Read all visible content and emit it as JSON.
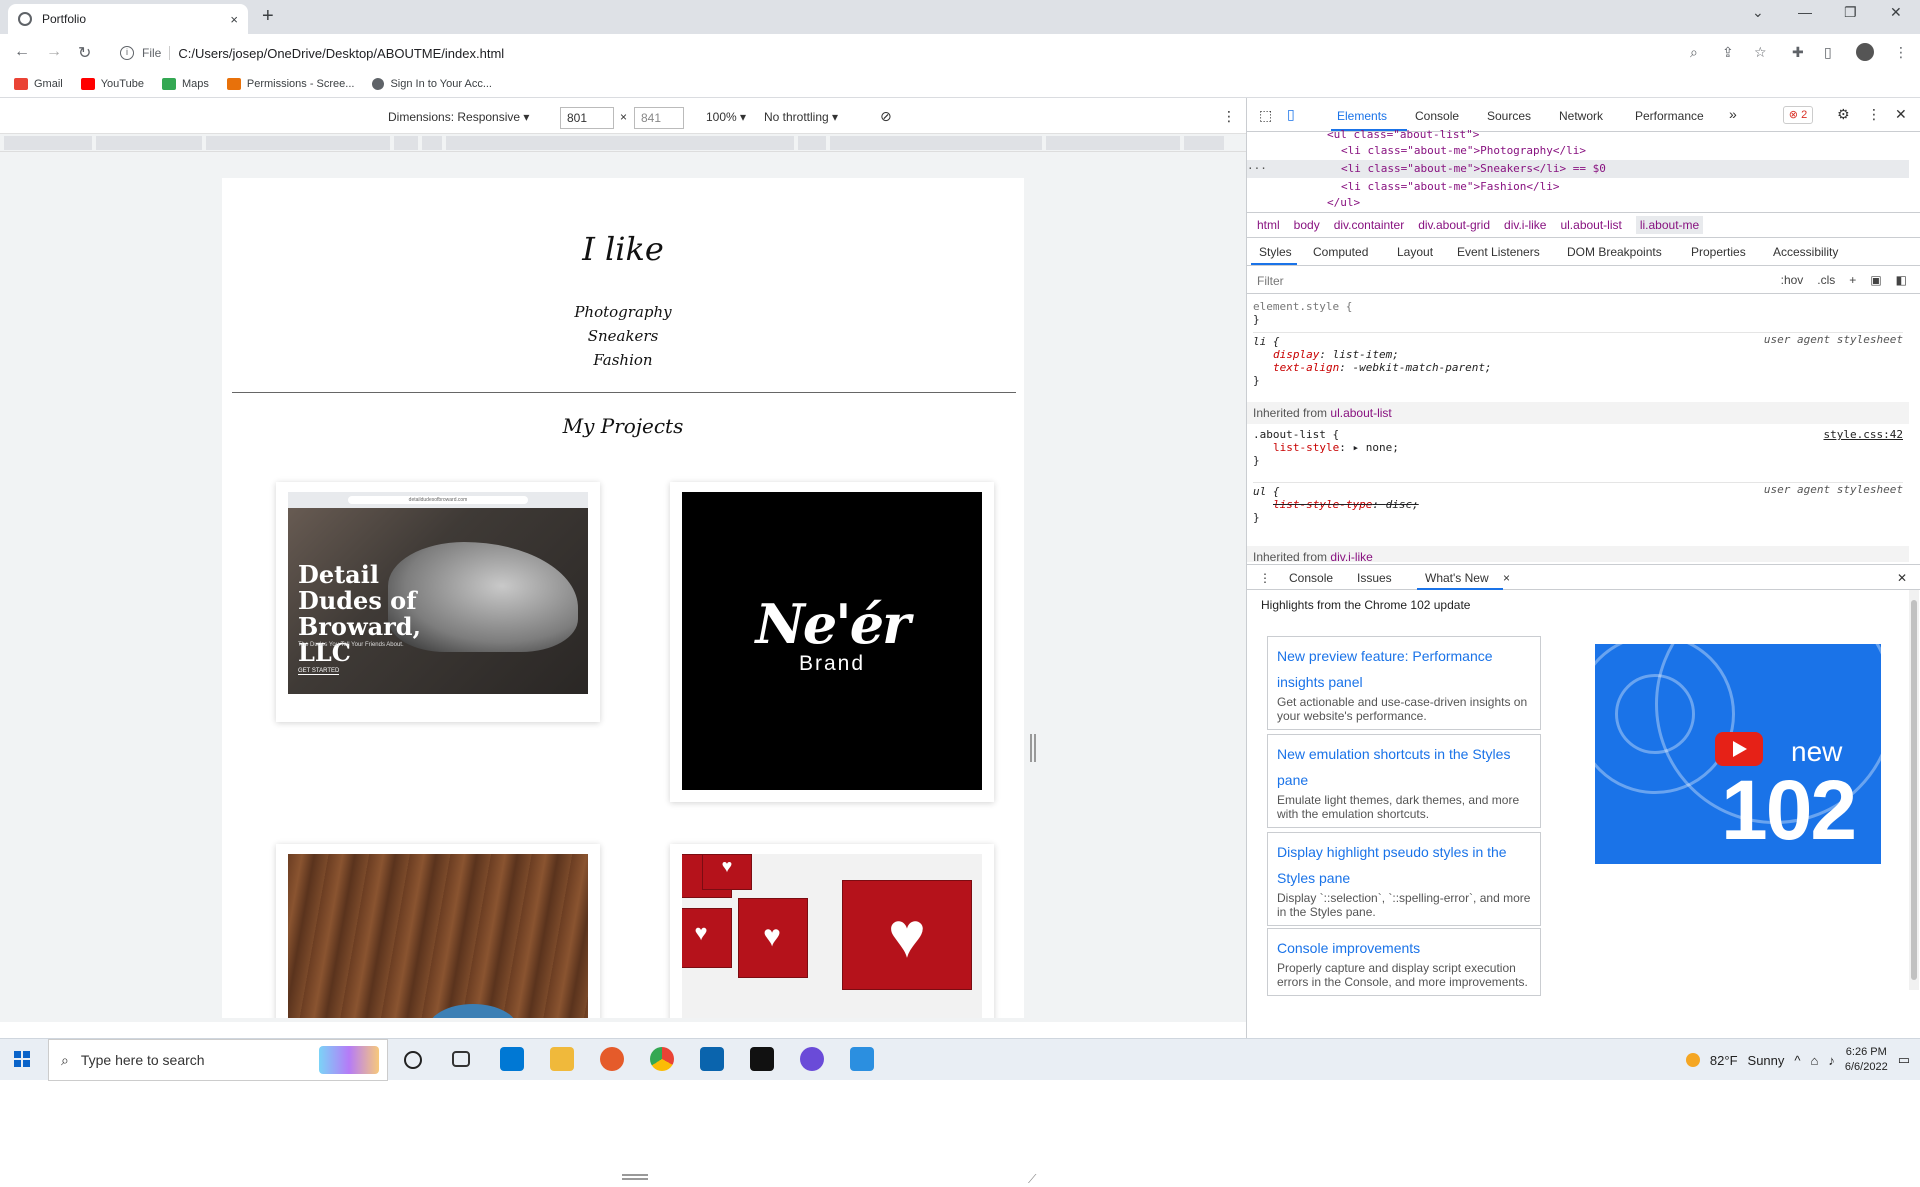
{
  "browser": {
    "tab_title": "Portfolio",
    "tab_close": "×",
    "new_tab": "+",
    "url_prefix": "File",
    "url": "C:/Users/josep/OneDrive/Desktop/ABOUTME/index.html",
    "bookmarks": [
      {
        "label": "Gmail",
        "color": "#ea4335"
      },
      {
        "label": "YouTube",
        "color": "#ff0000"
      },
      {
        "label": "Maps",
        "color": "#34a853"
      },
      {
        "label": "Permissions - Scree...",
        "color": "#e8710a"
      },
      {
        "label": "Sign In to Your Acc...",
        "color": "#5f6368"
      }
    ]
  },
  "device_toolbar": {
    "dimensions_label": "Dimensions: Responsive",
    "width": "801",
    "times": "×",
    "height": "841",
    "zoom": "100%",
    "throttling": "No throttling"
  },
  "page": {
    "like_title": "I like",
    "likes": [
      "Photography",
      "Sneakers",
      "Fashion"
    ],
    "projects_title": "My Projects",
    "card1": {
      "url": "detaildudesofbroward.com",
      "headline": "Detail Dudes of Broward, LLC",
      "sub": "The Dudes You Tell Your Friends About.",
      "cta": "GET STARTED"
    },
    "card2": {
      "logo": "Ne'ér",
      "brand": "Brand"
    }
  },
  "devtools": {
    "tabs": [
      "Elements",
      "Console",
      "Sources",
      "Network",
      "Performance"
    ],
    "more": "»",
    "error_count": "2",
    "dom_lines": [
      {
        "text": "<ul class=\"about-list\">"
      },
      {
        "text": "<li class=\"about-me\">Photography</li>"
      },
      {
        "text": "<li class=\"about-me\">Sneakers</li> == $0"
      },
      {
        "text": "<li class=\"about-me\">Fashion</li>"
      },
      {
        "text": "</ul>"
      }
    ],
    "breadcrumbs": [
      "html",
      "body",
      "div.containter",
      "div.about-grid",
      "div.i-like",
      "ul.about-list",
      "li.about-me"
    ],
    "subtabs": [
      "Styles",
      "Computed",
      "Layout",
      "Event Listeners",
      "DOM Breakpoints",
      "Properties",
      "Accessibility"
    ],
    "filter_placeholder": "Filter",
    "filter_tools": [
      ":hov",
      ".cls",
      "+"
    ],
    "styles": {
      "element_style": "element.style {",
      "close": "}",
      "li_selector": "li {",
      "li_source": "user agent stylesheet",
      "li_prop1": "display",
      "li_val1": "list-item;",
      "li_prop2": "text-align",
      "li_val2": "-webkit-match-parent;",
      "inherited1_label": "Inherited from",
      "inherited1_target": "ul.about-list",
      "aboutlist_selector": ".about-list {",
      "aboutlist_source": "style.css:42",
      "aboutlist_prop": "list-style",
      "aboutlist_val": "none;",
      "ul_selector": "ul {",
      "ul_source": "user agent stylesheet",
      "ul_prop": "list-style-type",
      "ul_val": "disc;",
      "inherited2_label": "Inherited from",
      "inherited2_target": "div.i-like"
    },
    "drawer_tabs": [
      "Console",
      "Issues",
      "What's New"
    ],
    "drawer_close": "×",
    "highlights": "Highlights from the Chrome 102 update",
    "news": [
      {
        "title": "New preview feature: Performance insights panel",
        "desc": "Get actionable and use-case-driven insights on your website's performance."
      },
      {
        "title": "New emulation shortcuts in the Styles pane",
        "desc": "Emulate light themes, dark themes, and more with the emulation shortcuts."
      },
      {
        "title": "Display highlight pseudo styles in the Styles pane",
        "desc": "Display `::selection`, `::spelling-error`, and more in the Styles pane."
      },
      {
        "title": "Console improvements",
        "desc": "Properly capture and display script execution errors in the Console, and more improvements."
      }
    ],
    "promo_new": "new",
    "promo_version": "102"
  },
  "taskbar": {
    "search_placeholder": "Type here to search",
    "weather_temp": "82°F",
    "weather_text": "Sunny",
    "time": "6:26 PM",
    "date": "6/6/2022"
  },
  "colors": {
    "accent": "#1a73e8",
    "card2_bg": "#000000",
    "heart_box": "#b5121b"
  }
}
